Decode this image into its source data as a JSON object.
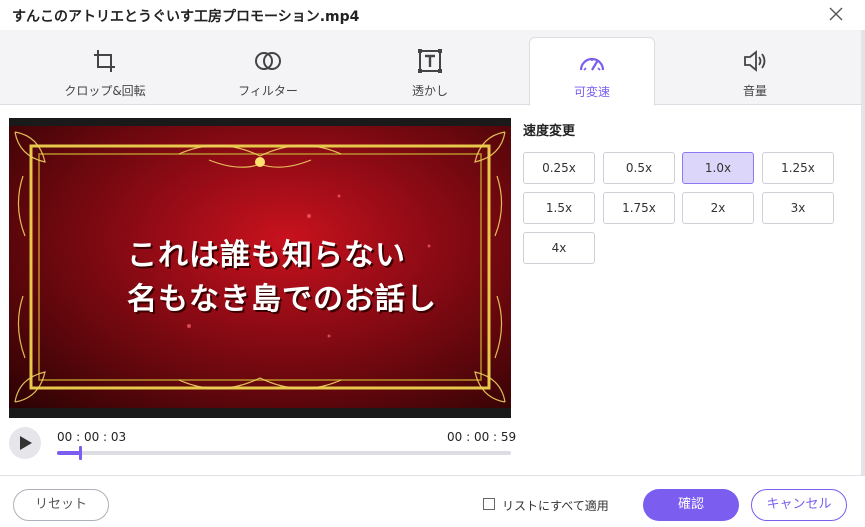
{
  "window": {
    "title": "すんこのアトリエとうぐいす工房プロモーション.mp4"
  },
  "tabs": [
    {
      "label": "クロップ&回転",
      "icon": "crop-rotate-icon",
      "active": false
    },
    {
      "label": "フィルター",
      "icon": "filter-icon",
      "active": false
    },
    {
      "label": "透かし",
      "icon": "watermark-icon",
      "active": false
    },
    {
      "label": "可変速",
      "icon": "speed-gauge-icon",
      "active": true
    },
    {
      "label": "音量",
      "icon": "volume-icon",
      "active": false
    }
  ],
  "preview": {
    "caption_line1": "これは誰も知らない",
    "caption_line2": "名もなき島でのお話し"
  },
  "playback": {
    "current_time": "00 : 00 : 03",
    "total_time": "00 : 00 : 59",
    "progress": 0.05
  },
  "speed": {
    "heading": "速度変更",
    "options": [
      "0.25x",
      "0.5x",
      "1.0x",
      "1.25x",
      "1.5x",
      "1.75x",
      "2x",
      "3x",
      "4x"
    ],
    "selected": "1.0x"
  },
  "footer": {
    "reset_label": "リセット",
    "apply_all_label": "リストにすべて適用",
    "apply_all_checked": false,
    "confirm_label": "確認",
    "cancel_label": "キャンセル"
  },
  "colors": {
    "accent": "#7b5df0",
    "selected_bg": "#dcd6fb"
  }
}
